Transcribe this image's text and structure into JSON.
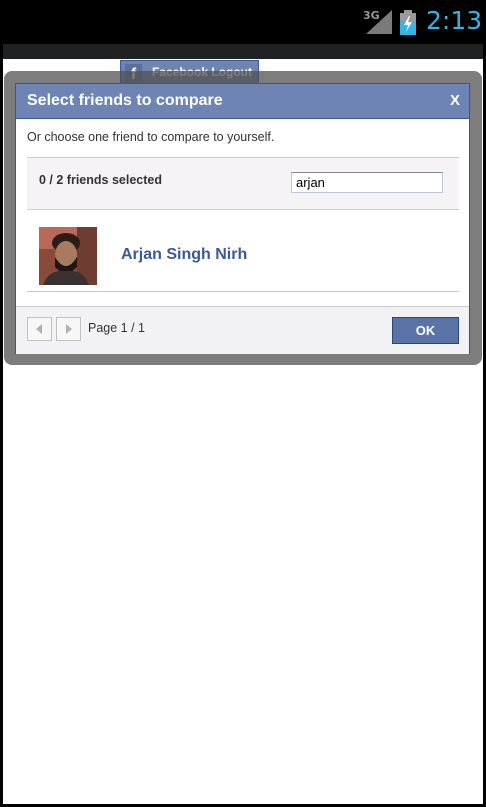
{
  "status_bar": {
    "network_label": "3G",
    "time": "2:13"
  },
  "facebook_button": {
    "icon_letter": "f",
    "label": "Facebook Logout"
  },
  "dialog": {
    "title": "Select friends to compare",
    "close_label": "X",
    "instruction": "Or choose one friend to compare to yourself.",
    "selected_count": "0 / 2 friends selected",
    "search_value": "arjan",
    "friends": [
      {
        "name": "Arjan Singh Nirh"
      }
    ],
    "page_indicator": "Page 1 / 1",
    "ok_label": "OK"
  },
  "colors": {
    "status_time": "#33b5e5",
    "header_bg": "#6d84b4",
    "friend_name": "#3b5998",
    "ok_button": "#5b74a8"
  }
}
